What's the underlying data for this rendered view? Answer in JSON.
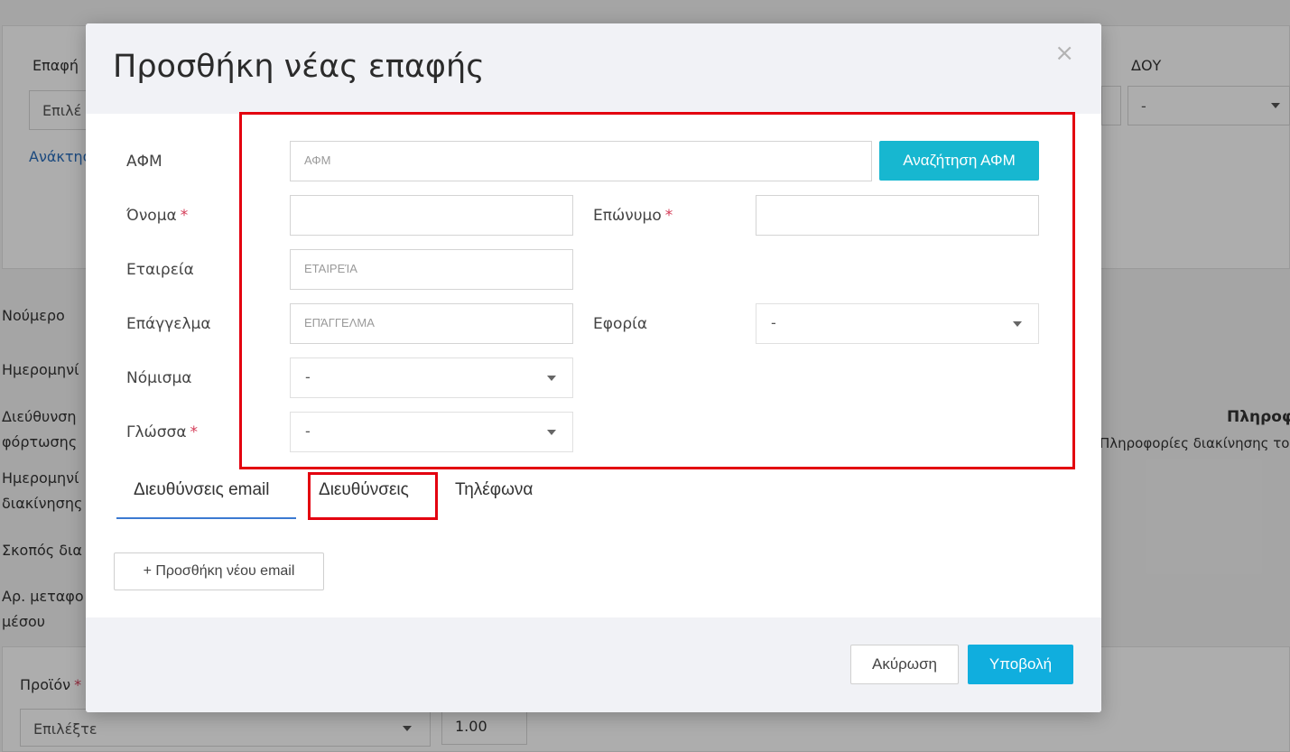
{
  "background": {
    "contact_label": "Επαφή",
    "contact_select": "Επιλέ",
    "doy_label": "ΔΟΥ",
    "doy_select": "-",
    "retrieve_link": "Ανάκτησ",
    "number_label": "Νούμερο",
    "date_label": "Ημερομηνί",
    "address_label_1": "Διεύθυνση",
    "address_label_2": "φόρτωσης",
    "movement_date_1": "Ημερομηνί",
    "movement_date_2": "διακίνησης",
    "purpose_label": "Σκοπός δια",
    "vehicle_label_1": "Αρ. μεταφο",
    "vehicle_label_2": "μέσου",
    "info_heading": "Πληροφ",
    "info_sub": "Πληροφορίες διακίνησης του",
    "product_label": "Προϊόν",
    "product_select": "Επιλέξτε",
    "quantity_value": "1.00"
  },
  "modal": {
    "title": "Προσθήκη νέας επαφής",
    "close_symbol": "×",
    "fields": {
      "afm_label": "ΑΦΜ",
      "afm_placeholder": "ΑΦΜ",
      "afm_search_button": "Αναζήτηση ΑΦΜ",
      "first_name_label": "Όνομα",
      "last_name_label": "Επώνυμο",
      "company_label": "Εταιρεία",
      "company_placeholder": "ΕΤΑΙΡΕΊΑ",
      "profession_label": "Επάγγελμα",
      "profession_placeholder": "ΕΠΆΓΓΕΛΜΑ",
      "tax_office_label": "Εφορία",
      "tax_office_value": "-",
      "currency_label": "Νόμισμα",
      "currency_value": "-",
      "language_label": "Γλώσσα",
      "language_value": "-",
      "required_mark": "*"
    },
    "tabs": [
      {
        "label": "Διευθύνσεις email",
        "active": true
      },
      {
        "label": "Διευθύνσεις",
        "active": false
      },
      {
        "label": "Τηλέφωνα",
        "active": false
      }
    ],
    "add_email_button": "+ Προσθήκη νέου email",
    "cancel_button": "Ακύρωση",
    "submit_button": "Υποβολή"
  },
  "colors": {
    "accent_cyan": "#17b7d0",
    "submit_blue": "#10aede",
    "required_red": "#d43b57",
    "annotation_red": "#e3000f",
    "tab_underline": "#3b7ad1"
  }
}
